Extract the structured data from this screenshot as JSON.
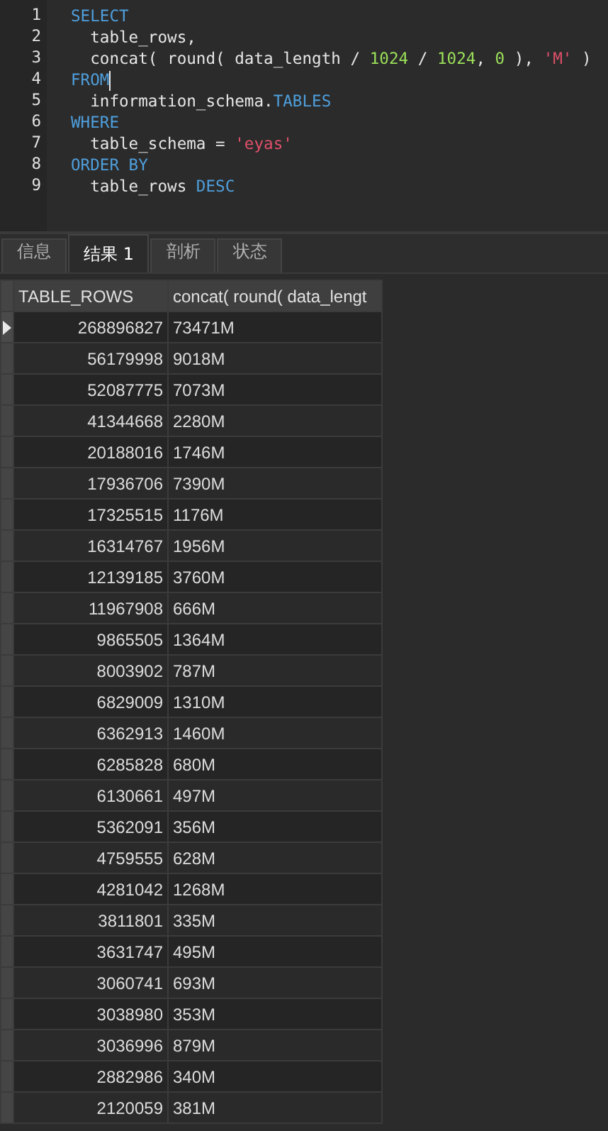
{
  "editor": {
    "lines": [
      {
        "number": "1",
        "cursor": false,
        "tokens": [
          {
            "kind": "keyword",
            "text": "SELECT"
          }
        ]
      },
      {
        "number": "2",
        "cursor": false,
        "tokens": [
          {
            "kind": "plain",
            "text": "  table_rows,"
          }
        ]
      },
      {
        "number": "3",
        "cursor": false,
        "tokens": [
          {
            "kind": "plain",
            "text": "  concat( round( data_length / "
          },
          {
            "kind": "number",
            "text": "1024"
          },
          {
            "kind": "plain",
            "text": " / "
          },
          {
            "kind": "number",
            "text": "1024"
          },
          {
            "kind": "plain",
            "text": ", "
          },
          {
            "kind": "number",
            "text": "0"
          },
          {
            "kind": "plain",
            "text": " ), "
          },
          {
            "kind": "string",
            "text": "'M'"
          },
          {
            "kind": "plain",
            "text": " )"
          }
        ]
      },
      {
        "number": "4",
        "cursor": true,
        "tokens": [
          {
            "kind": "keyword",
            "text": "FROM"
          }
        ]
      },
      {
        "number": "5",
        "cursor": false,
        "tokens": [
          {
            "kind": "plain",
            "text": "  information_schema."
          },
          {
            "kind": "keyword",
            "text": "TABLES"
          }
        ]
      },
      {
        "number": "6",
        "cursor": false,
        "tokens": [
          {
            "kind": "keyword",
            "text": "WHERE"
          }
        ]
      },
      {
        "number": "7",
        "cursor": false,
        "tokens": [
          {
            "kind": "plain",
            "text": "  table_schema = "
          },
          {
            "kind": "string",
            "text": "'eyas'"
          }
        ]
      },
      {
        "number": "8",
        "cursor": false,
        "tokens": [
          {
            "kind": "keyword",
            "text": "ORDER BY"
          }
        ]
      },
      {
        "number": "9",
        "cursor": false,
        "tokens": [
          {
            "kind": "plain",
            "text": "  table_rows "
          },
          {
            "kind": "keyword",
            "text": "DESC"
          }
        ]
      }
    ]
  },
  "tabs": [
    {
      "label": "信息",
      "selected": false
    },
    {
      "label": "结果 1",
      "selected": true
    },
    {
      "label": "剖析",
      "selected": false
    },
    {
      "label": "状态",
      "selected": false
    }
  ],
  "table": {
    "columns": [
      "TABLE_ROWS",
      "concat( round( data_lengt"
    ],
    "rows": [
      {
        "selected": true,
        "cells": [
          "268896827",
          "73471M"
        ]
      },
      {
        "selected": false,
        "cells": [
          "56179998",
          "9018M"
        ]
      },
      {
        "selected": false,
        "cells": [
          "52087775",
          "7073M"
        ]
      },
      {
        "selected": false,
        "cells": [
          "41344668",
          "2280M"
        ]
      },
      {
        "selected": false,
        "cells": [
          "20188016",
          "1746M"
        ]
      },
      {
        "selected": false,
        "cells": [
          "17936706",
          "7390M"
        ]
      },
      {
        "selected": false,
        "cells": [
          "17325515",
          "1176M"
        ]
      },
      {
        "selected": false,
        "cells": [
          "16314767",
          "1956M"
        ]
      },
      {
        "selected": false,
        "cells": [
          "12139185",
          "3760M"
        ]
      },
      {
        "selected": false,
        "cells": [
          "11967908",
          "666M"
        ]
      },
      {
        "selected": false,
        "cells": [
          "9865505",
          "1364M"
        ]
      },
      {
        "selected": false,
        "cells": [
          "8003902",
          "787M"
        ]
      },
      {
        "selected": false,
        "cells": [
          "6829009",
          "1310M"
        ]
      },
      {
        "selected": false,
        "cells": [
          "6362913",
          "1460M"
        ]
      },
      {
        "selected": false,
        "cells": [
          "6285828",
          "680M"
        ]
      },
      {
        "selected": false,
        "cells": [
          "6130661",
          "497M"
        ]
      },
      {
        "selected": false,
        "cells": [
          "5362091",
          "356M"
        ]
      },
      {
        "selected": false,
        "cells": [
          "4759555",
          "628M"
        ]
      },
      {
        "selected": false,
        "cells": [
          "4281042",
          "1268M"
        ]
      },
      {
        "selected": false,
        "cells": [
          "3811801",
          "335M"
        ]
      },
      {
        "selected": false,
        "cells": [
          "3631747",
          "495M"
        ]
      },
      {
        "selected": false,
        "cells": [
          "3060741",
          "693M"
        ]
      },
      {
        "selected": false,
        "cells": [
          "3038980",
          "353M"
        ]
      },
      {
        "selected": false,
        "cells": [
          "3036996",
          "879M"
        ]
      },
      {
        "selected": false,
        "cells": [
          "2882986",
          "340M"
        ]
      },
      {
        "selected": false,
        "cells": [
          "2120059",
          "381M"
        ]
      }
    ]
  }
}
